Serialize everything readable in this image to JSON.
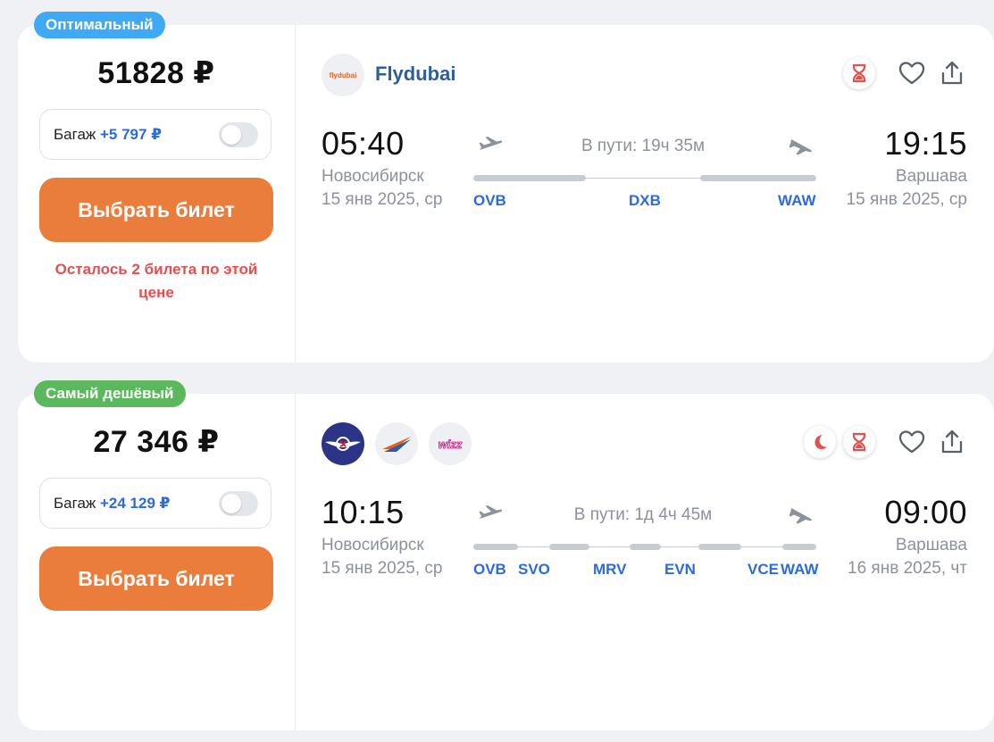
{
  "offers": [
    {
      "badge": "Оптимальный",
      "price": "51828 ₽",
      "baggage": {
        "label": "Багаж",
        "price": "+5 797 ₽"
      },
      "buy_label": "Выбрать билет",
      "remaining": "Осталось 2 билета по этой цене",
      "airline_name": "Flydubai",
      "logo_text": "flydubai",
      "depart_time": "05:40",
      "depart_city": "Новосибирск",
      "depart_date": "15 янв 2025, ср",
      "arrive_time": "19:15",
      "arrive_city": "Варшава",
      "arrive_date": "15 янв 2025, ср",
      "duration": "В пути: 19ч 35м",
      "codes": [
        "OVB",
        "DXB",
        "WAW"
      ],
      "icons": [
        "hourglass-icon",
        "heart-icon",
        "share-icon"
      ]
    },
    {
      "badge": "Самый дешёвый",
      "price": "27 346 ₽",
      "baggage": {
        "label": "Багаж",
        "price": "+24 129 ₽"
      },
      "buy_label": "Выбрать билет",
      "airline_logos": [
        "aeroflot-logo",
        "ural-airlines-logo",
        "wizz-air-logo"
      ],
      "depart_time": "10:15",
      "depart_city": "Новосибирск",
      "depart_date": "15 янв 2025, ср",
      "arrive_time": "09:00",
      "arrive_city": "Варшава",
      "arrive_date": "16 янв 2025, чт",
      "duration": "В пути: 1д 4ч 45м",
      "codes": [
        "OVB",
        "SVO",
        "MRV",
        "EVN",
        "VCE",
        "WAW"
      ],
      "icons": [
        "night-icon",
        "hourglass-icon",
        "heart-icon",
        "share-icon"
      ]
    }
  ],
  "colors": {
    "accent_orange": "#eb7d3c",
    "link_blue": "#2c6ae0",
    "badge_blue": "#3fa9f5",
    "badge_green": "#5bb85d",
    "warning_red": "#e2504f"
  }
}
